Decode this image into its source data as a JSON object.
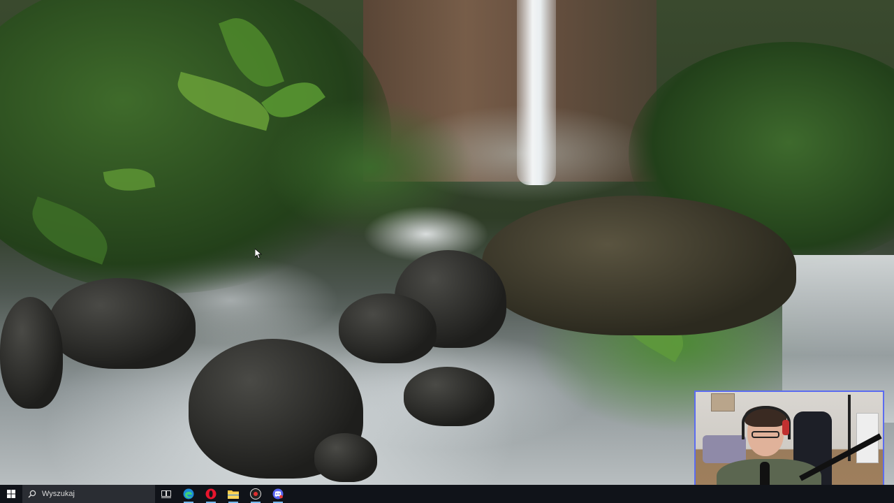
{
  "taskbar": {
    "search_placeholder": "Wyszukaj",
    "icons": [
      {
        "name": "task-view-icon",
        "active": false
      },
      {
        "name": "edge-icon",
        "active": true
      },
      {
        "name": "opera-icon",
        "active": true
      },
      {
        "name": "file-explorer-icon",
        "active": true
      },
      {
        "name": "recording-app-icon",
        "active": true
      },
      {
        "name": "discord-icon",
        "active": true
      }
    ]
  },
  "colors": {
    "taskbar_bg": "#101319",
    "webcam_border": "#5b6cf0",
    "active_indicator": "#76b9ed"
  }
}
